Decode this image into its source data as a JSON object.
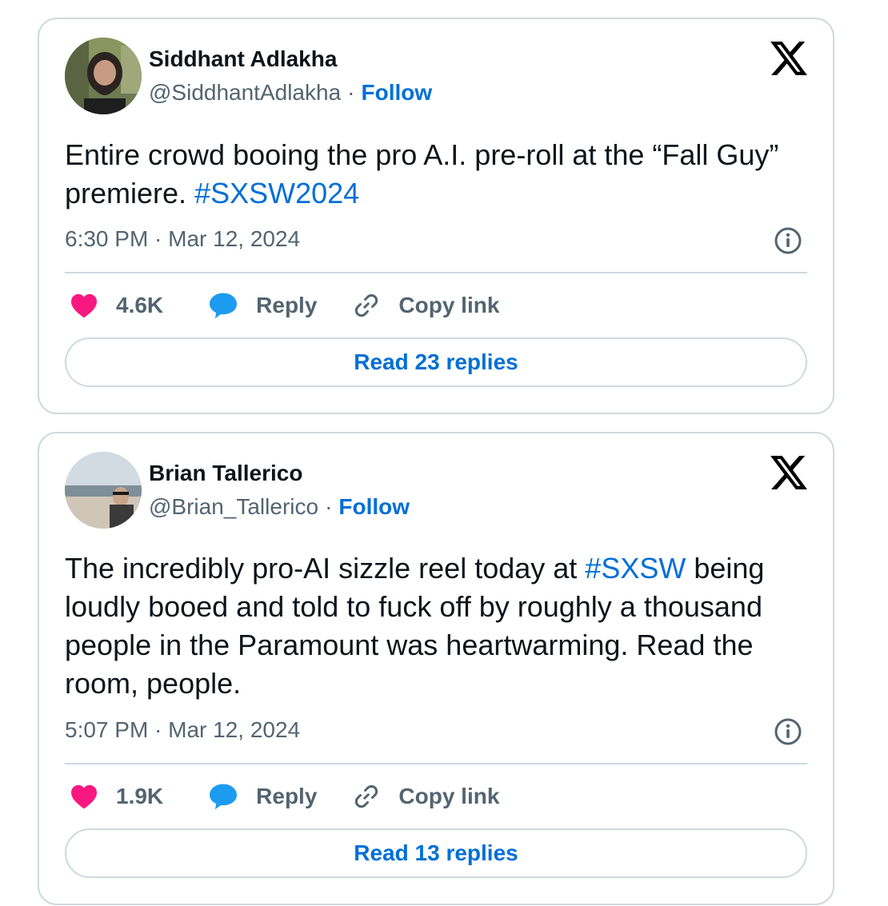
{
  "tweets": [
    {
      "author_name": "Siddhant Adlakha",
      "handle": "@SiddhantAdlakha",
      "separator": "·",
      "follow_label": "Follow",
      "text_plain": "Entire crowd booing the pro A.I. pre-roll at the “Fall Guy” premiere. ",
      "hashtag": "#SXSW2024",
      "timestamp": "6:30 PM · Mar 12, 2024",
      "likes": "4.6K",
      "reply_label": "Reply",
      "copy_link_label": "Copy link",
      "read_replies_label": "Read 23 replies",
      "avatar_icon": "avatar-bearded-man-photo"
    },
    {
      "author_name": "Brian Tallerico",
      "handle": "@Brian_Tallerico",
      "separator": "·",
      "follow_label": "Follow",
      "text_before": "The incredibly pro-AI sizzle reel today at ",
      "hashtag": "#SXSW",
      "text_after": " being loudly booed and told to fuck off by roughly a thousand people in the Paramount was heartwarming. Read the room, people.",
      "timestamp": "5:07 PM · Mar 12, 2024",
      "likes": "1.9K",
      "reply_label": "Reply",
      "copy_link_label": "Copy link",
      "read_replies_label": "Read 13 replies",
      "avatar_icon": "avatar-beach-photo"
    }
  ],
  "colors": {
    "text": "#0f1419",
    "secondary": "#536471",
    "link": "#006fd6",
    "border": "#cfd9de",
    "heart": "#f91880",
    "reply_bubble": "#1d9bf0"
  }
}
